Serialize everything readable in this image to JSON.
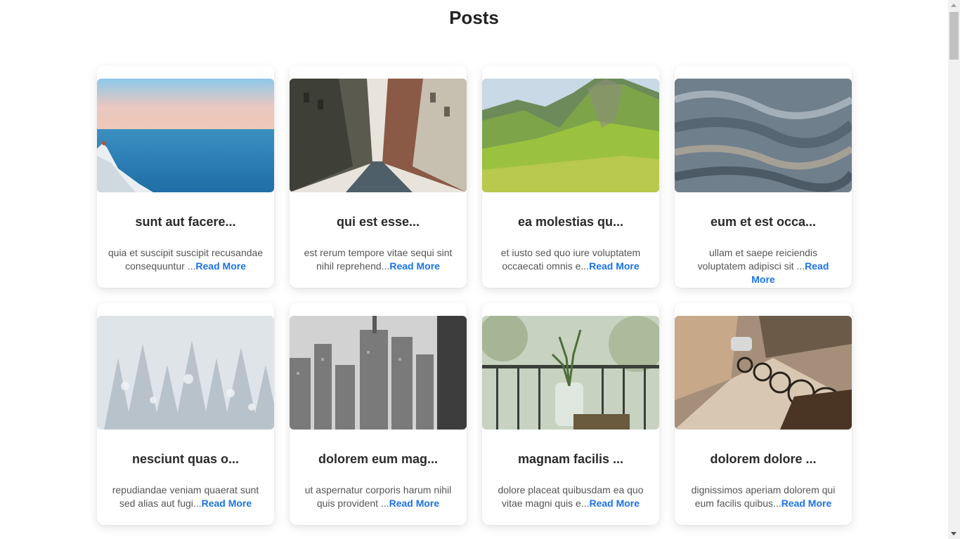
{
  "page": {
    "title": "Posts"
  },
  "posts": [
    {
      "title": "sunt aut facere...",
      "excerpt": "quia et suscipit suscipit recusandae consequuntur ...",
      "link": "Read More",
      "image_icon": "sea-cliff-image"
    },
    {
      "title": "qui est esse...",
      "excerpt": "est rerum tempore vitae sequi sint nihil reprehend...",
      "link": "Read More",
      "image_icon": "city-street-image"
    },
    {
      "title": "ea molestias qu...",
      "excerpt": "et iusto sed quo iure voluptatem occaecati omnis e...",
      "link": "Read More",
      "image_icon": "green-mountain-image"
    },
    {
      "title": "eum et est occa...",
      "excerpt": "ullam et saepe reiciendis voluptatem adipisci sit ...",
      "link": "Read More",
      "image_icon": "water-texture-image"
    },
    {
      "title": "nesciunt quas o...",
      "excerpt": "repudiandae veniam quaerat sunt sed alias aut fugi...",
      "link": "Read More",
      "image_icon": "snowy-forest-image"
    },
    {
      "title": "dolorem eum mag...",
      "excerpt": "ut aspernatur corporis harum nihil quis provident ...",
      "link": "Read More",
      "image_icon": "city-skyline-image"
    },
    {
      "title": "magnam facilis ...",
      "excerpt": "dolore placeat quibusdam ea quo vitae magni quis e...",
      "link": "Read More",
      "image_icon": "balcony-plant-image"
    },
    {
      "title": "dolorem dolore ...",
      "excerpt": "dignissimos aperiam dolorem qui eum facilis quibus...",
      "link": "Read More",
      "image_icon": "bicycle-street-image"
    }
  ],
  "colors": {
    "link": "#1a73e8",
    "title": "#2a2a2a",
    "text": "#555555"
  }
}
